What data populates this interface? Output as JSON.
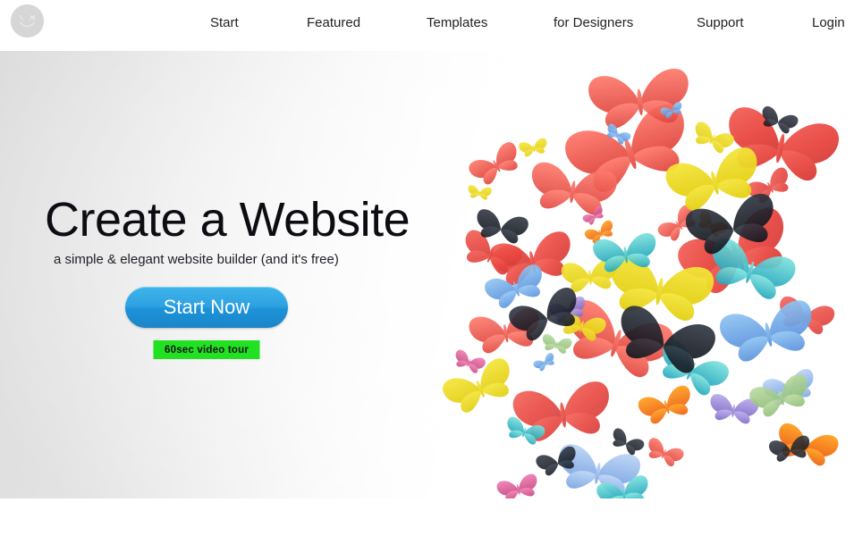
{
  "header": {
    "logo": {
      "icon": "smiley-face-logo",
      "color": "#d6d6d6"
    },
    "nav": [
      {
        "key": "start",
        "label": "Start"
      },
      {
        "key": "featured",
        "label": "Featured"
      },
      {
        "key": "templates",
        "label": "Templates"
      },
      {
        "key": "designers",
        "label": "for Designers"
      },
      {
        "key": "support",
        "label": "Support"
      },
      {
        "key": "login",
        "label": "Login"
      }
    ]
  },
  "hero": {
    "headline": "Create a Website",
    "subhead": "a simple & elegant website builder (and it's free)",
    "cta_primary": "Start Now",
    "cta_secondary": "60sec video tour",
    "artwork": "butterflies-collage",
    "colors": {
      "cta_primary_bg": "#2fa3e2",
      "cta_secondary_bg": "#22e022",
      "background_left": "#dddddd",
      "background_right": "#ffffff"
    }
  }
}
